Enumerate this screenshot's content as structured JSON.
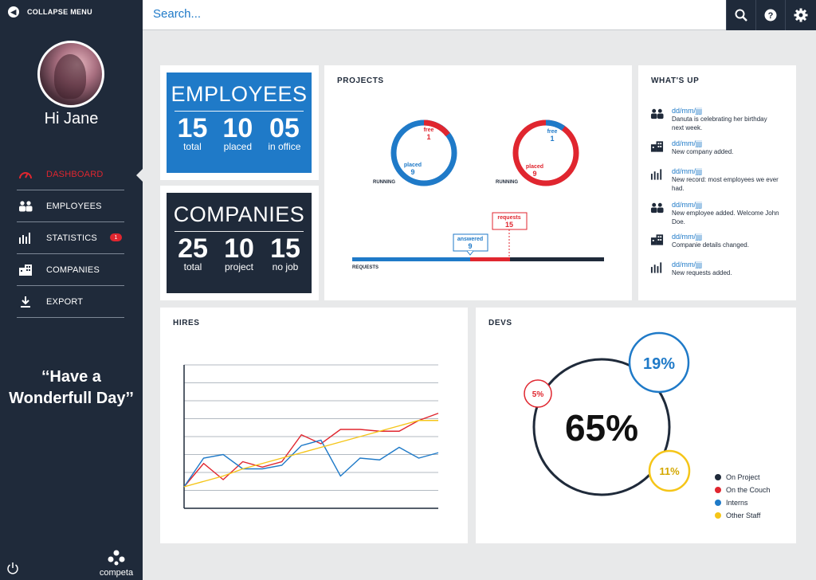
{
  "sidebar": {
    "collapse_label": "COLLAPSE MENU",
    "greeting": "Hi Jane",
    "nav": [
      {
        "label": "DASHBOARD",
        "icon": "gauge-icon"
      },
      {
        "label": "EMPLOYEES",
        "icon": "people-icon"
      },
      {
        "label": "STATISTICS",
        "icon": "bars-icon",
        "badge": "1"
      },
      {
        "label": "COMPANIES",
        "icon": "buildings-icon"
      },
      {
        "label": "EXPORT",
        "icon": "download-icon"
      }
    ],
    "quote": "‘‘Have a Wonderfull Day’’",
    "logo_text": "competa"
  },
  "topbar": {
    "search_placeholder": "Search..."
  },
  "employees": {
    "title": "EMPLOYEES",
    "stats": [
      {
        "value": "15",
        "label": "total"
      },
      {
        "value": "10",
        "label": "placed"
      },
      {
        "value": "05",
        "label": "in office"
      }
    ]
  },
  "companies": {
    "title": "COMPANIES",
    "stats": [
      {
        "value": "25",
        "label": "total"
      },
      {
        "value": "10",
        "label": "project"
      },
      {
        "value": "15",
        "label": "no job"
      }
    ]
  },
  "projects": {
    "title": "PROJECTS",
    "ring1": {
      "top_label": "free",
      "top_value": "1",
      "bottom_label": "placed",
      "bottom_value": "9",
      "caption": "RUNNING"
    },
    "ring2": {
      "top_label": "free",
      "top_value": "1",
      "bottom_label": "placed",
      "bottom_value": "9",
      "caption": "RUNNING"
    },
    "requests": {
      "label": "REQUESTS",
      "answered_label": "answered",
      "answered_value": "9",
      "requests_label": "requests",
      "requests_value": "15"
    }
  },
  "whatsup": {
    "title": "WHAT'S UP",
    "items": [
      {
        "icon": "people-icon",
        "date": "dd/mm/jjjj",
        "text": "Danuta is celebrating her birthday next week."
      },
      {
        "icon": "buildings-icon",
        "date": "dd/mm/jjjj",
        "text": "New company added."
      },
      {
        "icon": "bars-icon",
        "date": "dd/mm/jjjj",
        "text": "New record: most employees we ever had."
      },
      {
        "icon": "people-icon",
        "date": "dd/mm/jjjj",
        "text": "New employee added. Welcome John Doe."
      },
      {
        "icon": "buildings-icon",
        "date": "dd/mm/jjjj",
        "text": "Companie details changed."
      },
      {
        "icon": "bars-icon",
        "date": "dd/mm/jjjj",
        "text": "New requests added."
      }
    ]
  },
  "hires": {
    "title": "HIRES",
    "chart_data": {
      "type": "line",
      "x": [
        0,
        1,
        2,
        3,
        4,
        5,
        6,
        7,
        8,
        9,
        10,
        11,
        12,
        13
      ],
      "ylim": [
        0,
        8
      ],
      "series": [
        {
          "values": [
            1.2,
            2.5,
            1.6,
            2.6,
            2.3,
            2.6,
            4.1,
            3.6,
            4.4,
            4.4,
            4.3,
            4.3,
            4.9,
            5.3
          ],
          "color": "#e0262f"
        },
        {
          "values": [
            1.2,
            2.8,
            3.0,
            2.2,
            2.2,
            2.4,
            3.5,
            3.8,
            1.8,
            2.8,
            2.7,
            3.4,
            2.8,
            3.1
          ],
          "color": "#1f7ac8"
        },
        {
          "values": [
            1.2,
            1.5,
            1.8,
            2.2,
            2.5,
            2.8,
            3.1,
            3.4,
            3.7,
            4.0,
            4.3,
            4.6,
            4.9,
            4.9
          ],
          "color": "#f5c518"
        }
      ]
    }
  },
  "devs": {
    "title": "DEVS",
    "main_value": "65%",
    "bubble_blue": "19%",
    "bubble_red": "5%",
    "bubble_yellow": "11%",
    "legend": [
      {
        "label": "On Project",
        "color": "#1f2a3a"
      },
      {
        "label": "On the Couch",
        "color": "#e0262f"
      },
      {
        "label": "Interns",
        "color": "#1f7ac8"
      },
      {
        "label": "Other Staff",
        "color": "#f5c518"
      }
    ]
  }
}
